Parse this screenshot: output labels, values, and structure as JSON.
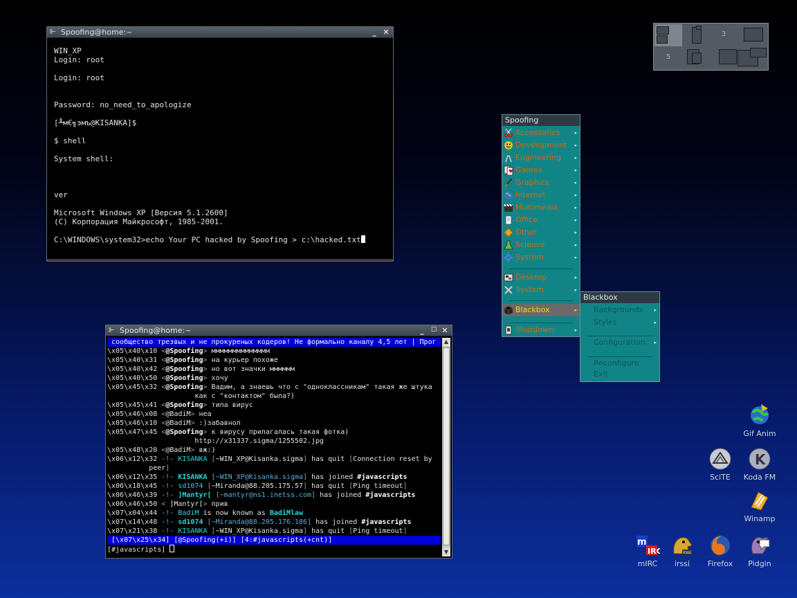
{
  "terminal": {
    "title": "Spoofing@home:~",
    "lines": [
      "WIN_XP",
      "Login: root",
      "",
      "Login: root",
      "",
      "",
      "Password: no_need_to_apologize",
      "",
      "[╨м€╗эмъ@KISANKA]$",
      "",
      "$ shell",
      "",
      "System shell:",
      "",
      "",
      "",
      "ver",
      "",
      "Microsoft Windows XP [Версия 5.1.2600]",
      "(C) Корпорация Майкрософт, 1985-2001.",
      "",
      "C:\\WINDOWS\\system32>echo Your PC hacked by Spoofing > c:\\hacked.txt"
    ]
  },
  "irc_window": {
    "title": "Spoofing@home:~",
    "topic": " сообщество трезвых и не прокуреных кодеров! Не формально каналу 4,5 лет | Прог",
    "lines": [
      [
        {
          "t": "\\x05\\x40\\x10 ",
          "c": ""
        },
        {
          "t": "<",
          "c": "gray"
        },
        {
          "t": "@Spoofing",
          "c": "nk"
        },
        {
          "t": ">",
          "c": "gray"
        },
        {
          "t": " мммммммммммммм",
          "c": ""
        }
      ],
      [
        {
          "t": "\\x05\\x40\\x31 ",
          "c": ""
        },
        {
          "t": "<",
          "c": "gray"
        },
        {
          "t": "@Spoofing",
          "c": "nk"
        },
        {
          "t": ">",
          "c": "gray"
        },
        {
          "t": " на курьер похоже",
          "c": ""
        }
      ],
      [
        {
          "t": "\\x05\\x40\\x42 ",
          "c": ""
        },
        {
          "t": "<",
          "c": "gray"
        },
        {
          "t": "@Spoofing",
          "c": "nk"
        },
        {
          "t": ">",
          "c": "gray"
        },
        {
          "t": " но вот значки мммммм",
          "c": ""
        }
      ],
      [
        {
          "t": "\\x05\\x40\\x50 ",
          "c": ""
        },
        {
          "t": "<",
          "c": "gray"
        },
        {
          "t": "@Spoofing",
          "c": "nk"
        },
        {
          "t": ">",
          "c": "gray"
        },
        {
          "t": " хочу",
          "c": ""
        }
      ],
      [
        {
          "t": "\\x05\\x45\\x32 ",
          "c": ""
        },
        {
          "t": "<",
          "c": "gray"
        },
        {
          "t": "@Spoofing",
          "c": "nk"
        },
        {
          "t": ">",
          "c": "gray"
        },
        {
          "t": " Вадим, а знаешь что с \"одноклассникам\" такая же штука",
          "c": ""
        }
      ],
      [
        {
          "t": "                     как с \"контактом\" была?)",
          "c": ""
        }
      ],
      [
        {
          "t": "\\x05\\x45\\x41 ",
          "c": ""
        },
        {
          "t": "<",
          "c": "gray"
        },
        {
          "t": "@Spoofing",
          "c": "nk"
        },
        {
          "t": ">",
          "c": "gray"
        },
        {
          "t": " типа вирус",
          "c": ""
        }
      ],
      [
        {
          "t": "\\x05\\x46\\x08 ",
          "c": ""
        },
        {
          "t": "<",
          "c": "gray"
        },
        {
          "t": "@BadiM",
          "c": ""
        },
        {
          "t": ">",
          "c": "gray"
        },
        {
          "t": " неа",
          "c": ""
        }
      ],
      [
        {
          "t": "\\x05\\x46\\x10 ",
          "c": ""
        },
        {
          "t": "<",
          "c": "gray"
        },
        {
          "t": "@BadiM",
          "c": ""
        },
        {
          "t": ">",
          "c": "gray"
        },
        {
          "t": " :)забавнол",
          "c": ""
        }
      ],
      [
        {
          "t": "\\x05\\x47\\x45 ",
          "c": ""
        },
        {
          "t": "<",
          "c": "gray"
        },
        {
          "t": "@Spoofing",
          "c": "nk"
        },
        {
          "t": ">",
          "c": "gray"
        },
        {
          "t": " к вирусу прилагалась такая фотка)",
          "c": ""
        }
      ],
      [
        {
          "t": "                     http://x31337.sigma/1255502.jpg",
          "c": ""
        }
      ],
      [
        {
          "t": "\\x05\\x48\\x20 ",
          "c": ""
        },
        {
          "t": "<",
          "c": "gray"
        },
        {
          "t": "@BadiM",
          "c": ""
        },
        {
          "t": ">",
          "c": "gray"
        },
        {
          "t": " вж:)",
          "c": ""
        }
      ],
      [
        {
          "t": "\\x06\\x12\\x32 ",
          "c": ""
        },
        {
          "t": "-!- ",
          "c": "ct"
        },
        {
          "t": "KISANKA ",
          "c": "cy"
        },
        {
          "t": "[",
          "c": "gray"
        },
        {
          "t": "~WIN_XP@Kisanka.sigma",
          "c": ""
        },
        {
          "t": "]",
          "c": "gray"
        },
        {
          "t": " has quit ",
          "c": ""
        },
        {
          "t": "[",
          "c": "gray"
        },
        {
          "t": "Connection reset by",
          "c": ""
        }
      ],
      [
        {
          "t": "          peer",
          "c": ""
        },
        {
          "t": "]",
          "c": "gray"
        }
      ],
      [
        {
          "t": "\\x06\\x12\\x35 ",
          "c": ""
        },
        {
          "t": "-!- ",
          "c": "ct"
        },
        {
          "t": "KISANKA ",
          "c": "cyb"
        },
        {
          "t": "[",
          "c": "gray"
        },
        {
          "t": "~WIN_XP@Kisanka.sigma",
          "c": "ct"
        },
        {
          "t": "]",
          "c": "gray"
        },
        {
          "t": " has joined ",
          "c": ""
        },
        {
          "t": "#javascripts",
          "c": "wh"
        }
      ],
      [
        {
          "t": "\\x06\\x18\\x45 ",
          "c": ""
        },
        {
          "t": "-!- ",
          "c": "ct"
        },
        {
          "t": "sd1074 ",
          "c": "cy"
        },
        {
          "t": "[",
          "c": "gray"
        },
        {
          "t": "~Miranda@88.205.175.57",
          "c": ""
        },
        {
          "t": "]",
          "c": "gray"
        },
        {
          "t": " has quit ",
          "c": ""
        },
        {
          "t": "[",
          "c": "gray"
        },
        {
          "t": "Ping timeout",
          "c": ""
        },
        {
          "t": "]",
          "c": "gray"
        }
      ],
      [
        {
          "t": "\\x06\\x46\\x39 ",
          "c": ""
        },
        {
          "t": "-!- ",
          "c": "ct"
        },
        {
          "t": "]Mantyr[ ",
          "c": "cyb"
        },
        {
          "t": "[",
          "c": "gray"
        },
        {
          "t": "~mantyr@ns1.inetss.com",
          "c": "ct"
        },
        {
          "t": "]",
          "c": "gray"
        },
        {
          "t": " has joined ",
          "c": ""
        },
        {
          "t": "#javascripts",
          "c": "wh"
        }
      ],
      [
        {
          "t": "\\x06\\x46\\x50 ",
          "c": ""
        },
        {
          "t": "<",
          "c": "gray"
        },
        {
          "t": " ]Mantyr[",
          "c": ""
        },
        {
          "t": ">",
          "c": "gray"
        },
        {
          "t": " прив",
          "c": ""
        }
      ],
      [
        {
          "t": "\\x07\\x04\\x44 ",
          "c": ""
        },
        {
          "t": "-!- ",
          "c": "ct"
        },
        {
          "t": "BadiM",
          "c": "cy"
        },
        {
          "t": " is now known as ",
          "c": ""
        },
        {
          "t": "BadiMlaw",
          "c": "cyb"
        }
      ],
      [
        {
          "t": "\\x07\\x14\\x48 ",
          "c": ""
        },
        {
          "t": "-!- ",
          "c": "ct"
        },
        {
          "t": "sd1074 ",
          "c": "cyb"
        },
        {
          "t": "[",
          "c": "gray"
        },
        {
          "t": "~Miranda@88.205.176.186",
          "c": "ct"
        },
        {
          "t": "]",
          "c": "gray"
        },
        {
          "t": " has joined ",
          "c": ""
        },
        {
          "t": "#javascripts",
          "c": "wh"
        }
      ],
      [
        {
          "t": "\\x07\\x21\\x38 ",
          "c": ""
        },
        {
          "t": "-!- ",
          "c": "ct"
        },
        {
          "t": "KISANKA ",
          "c": "cy"
        },
        {
          "t": "[",
          "c": "gray"
        },
        {
          "t": "~WIN_XP@Kisanka.sigma",
          "c": ""
        },
        {
          "t": "]",
          "c": "gray"
        },
        {
          "t": " has quit ",
          "c": ""
        },
        {
          "t": "[",
          "c": "gray"
        },
        {
          "t": "Ping timeout",
          "c": ""
        },
        {
          "t": "]",
          "c": "gray"
        }
      ]
    ],
    "status": " [\\x07\\x25\\x34] [@Spoofing(+i)] [4:#javascripts(+cnt)]",
    "input": "[#javascripts] "
  },
  "pager": {
    "desktops": [
      {
        "num": "",
        "active": true
      },
      {
        "num": "",
        "active": false
      },
      {
        "num": "3",
        "active": false
      },
      {
        "num": "",
        "active": false
      },
      {
        "num": "5",
        "active": false
      },
      {
        "num": "",
        "active": false
      },
      {
        "num": "",
        "active": false
      },
      {
        "num": "",
        "active": false
      }
    ]
  },
  "root_menu": {
    "title": "Spoofing",
    "items": [
      {
        "label": "Accessories",
        "icon": "scissors-icon",
        "color": "#d01010"
      },
      {
        "label": "Development",
        "icon": "smiley-icon",
        "color": "#e8d020"
      },
      {
        "label": "Engineering",
        "icon": "compass-icon",
        "color": "#cccccc"
      },
      {
        "label": "Games",
        "icon": "cards-icon",
        "color": "#ffffff"
      },
      {
        "label": "Graphics",
        "icon": "brush-icon",
        "color": "#e06020"
      },
      {
        "label": "Internet",
        "icon": "globe-icon",
        "color": "#3a70c0"
      },
      {
        "label": "Multimedia",
        "icon": "clapper-icon",
        "color": "#ffffff"
      },
      {
        "label": "Office",
        "icon": "office-icon",
        "color": "#60a0d0"
      },
      {
        "label": "Other",
        "icon": "diamond-icon",
        "color": "#f0a020"
      },
      {
        "label": "Science",
        "icon": "science-icon",
        "color": "#60c040"
      },
      {
        "label": "System",
        "icon": "gear-icon",
        "color": "#4080d0"
      },
      {
        "label": "Desktop",
        "icon": "desktop-icon",
        "color": "#dddddd"
      },
      {
        "label": "System",
        "icon": "tools-icon",
        "color": "#cccccc"
      },
      {
        "label": "Blackbox",
        "icon": "blackbox-icon",
        "color": "#222222",
        "selected": true
      },
      {
        "label": "Shutdown",
        "icon": "shutdown-icon",
        "color": "#dddddd"
      }
    ]
  },
  "submenu": {
    "title": "Blackbox",
    "items": [
      {
        "label": "Backgrounds",
        "arrow": true
      },
      {
        "label": "Styles",
        "arrow": true
      },
      {
        "label": "Configuration",
        "arrow": true
      },
      {
        "label": "Reconfigure",
        "arrow": false
      },
      {
        "label": "Exit",
        "arrow": false
      }
    ]
  },
  "desktop_icons": [
    {
      "label": "Gif Anim",
      "icon": "gif-anim-icon"
    },
    {
      "label": "SciTE",
      "icon": "scite-icon"
    },
    {
      "label": "Koda FM",
      "icon": "koda-fm-icon"
    },
    {
      "label": "Winamp",
      "icon": "winamp-icon"
    },
    {
      "label": "mIRC",
      "icon": "mirc-icon"
    },
    {
      "label": "irssi",
      "icon": "irssi-icon"
    },
    {
      "label": "Firefox",
      "icon": "firefox-icon"
    },
    {
      "label": "Pidgin",
      "icon": "pidgin-icon"
    }
  ]
}
